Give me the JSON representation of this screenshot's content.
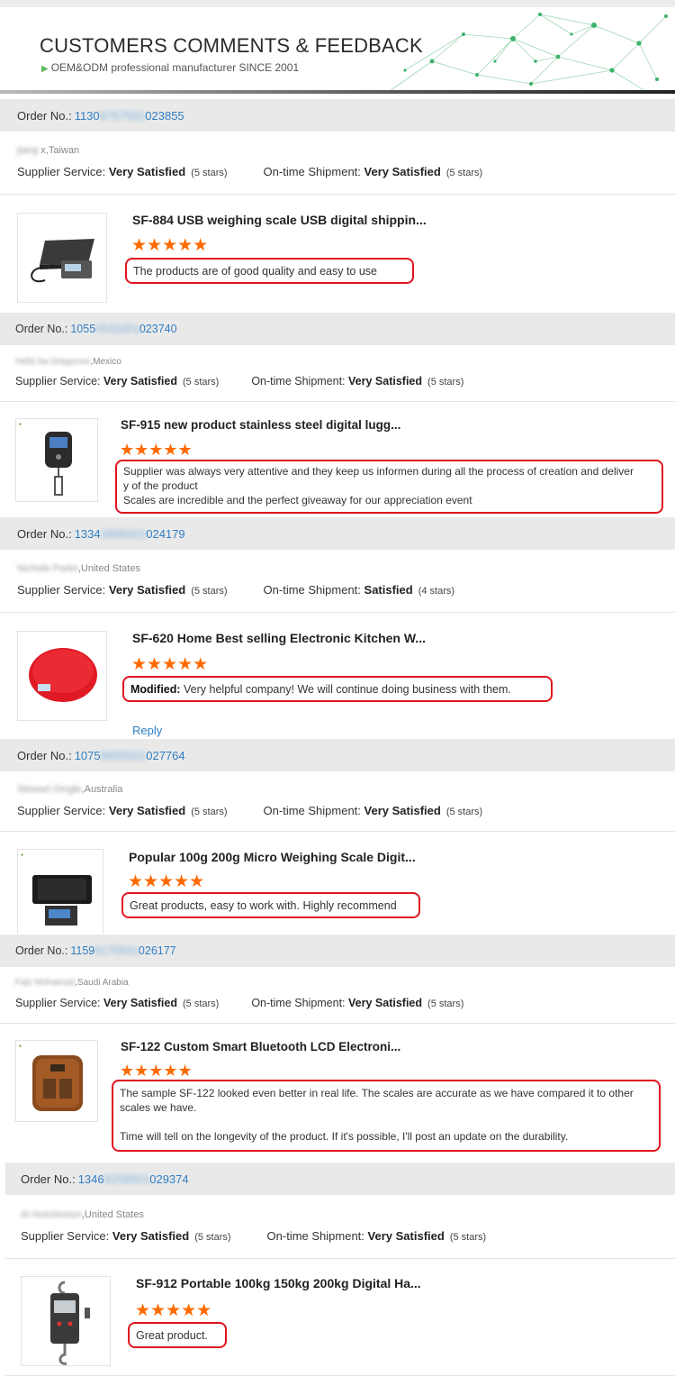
{
  "header": {
    "title": "CUSTOMERS COMMENTS & FEEDBACK",
    "subtitle": "OEM&ODM professional manufacturer SINCE 2001"
  },
  "labels": {
    "order_no": "Order No.:",
    "supplier_service": "Supplier Service:",
    "on_time_shipment": "On-time Shipment:",
    "reply": "Reply",
    "modified": "Modified:"
  },
  "stars_glyph": "★★★★★",
  "reviews": [
    {
      "order_prefix": "1130",
      "order_hidden": "9767501",
      "order_suffix": "023855",
      "customer_hidden": "jiang",
      "customer_visible": " x,Taiwan",
      "service": "Very Satisfied",
      "service_stars": "(5 stars)",
      "shipment": "Very Satisfied",
      "shipment_stars": "(5 stars)",
      "product": "SF-884 USB weighing scale USB digital shippin...",
      "comment_lines": [
        "The products are of good quality and easy to use"
      ]
    },
    {
      "order_prefix": "1055",
      "order_hidden": "0531001",
      "order_suffix": "023740",
      "customer_hidden": "Hefzi ba Dragonne",
      "customer_visible": ",Mexico",
      "service": "Very Satisfied",
      "service_stars": "(5 stars)",
      "shipment": "Very Satisfied",
      "shipment_stars": "(5 stars)",
      "product": "SF-915 new product stainless steel digital lugg...",
      "comment_lines": [
        "Supplier was always very attentive and they keep us informen during all the process of creation and deliver",
        "y of the product",
        "Scales are incredible and the perfect giveaway for our appreciation event"
      ]
    },
    {
      "order_prefix": "1334",
      "order_hidden": "2895001",
      "order_suffix": "024179",
      "customer_hidden": "Nichole Parks",
      "customer_visible": ",United States",
      "service": "Very Satisfied",
      "service_stars": "(5 stars)",
      "shipment": "Satisfied",
      "shipment_stars": "(4 stars)",
      "product": "SF-620 Home Best selling Electronic Kitchen W...",
      "modified_text": "Very helpful company! We will continue doing business with them."
    },
    {
      "order_prefix": "1075",
      "order_hidden": "8955501",
      "order_suffix": "027764",
      "customer_hidden": "Stewart Dingle",
      "customer_visible": ",Australia",
      "service": "Very Satisfied",
      "service_stars": "(5 stars)",
      "shipment": "Very Satisfied",
      "shipment_stars": "(5 stars)",
      "product": "Popular 100g 200g Micro Weighing Scale Digit...",
      "comment_lines": [
        "Great products, easy to work with. Highly recommend"
      ]
    },
    {
      "order_prefix": "1159",
      "order_hidden": "6170501",
      "order_suffix": "026177",
      "customer_hidden": "Faiz Mohamad",
      "customer_visible": ",Saudi Arabia",
      "service": "Very Satisfied",
      "service_stars": "(5 stars)",
      "shipment": "Very Satisfied",
      "shipment_stars": "(5 stars)",
      "product": "SF-122 Custom Smart Bluetooth LCD Electroni...",
      "comment_lines": [
        "The sample SF-122 looked even better in real life. The scales are accurate as we have compared it to other",
        "scales we have.",
        "",
        "Time will tell on the longevity of the product. If it's possible, I'll post an update on the durability."
      ]
    },
    {
      "order_prefix": "1346",
      "order_hidden": "9259501",
      "order_suffix": "029374",
      "customer_hidden": "Al Hutchinson",
      "customer_visible": ",United States",
      "service": "Very Satisfied",
      "service_stars": "(5 stars)",
      "shipment": "Very Satisfied",
      "shipment_stars": "(5 stars)",
      "product": "SF-912 Portable 100kg 150kg 200kg Digital Ha...",
      "comment_lines": [
        "Great product."
      ]
    }
  ],
  "colors": {
    "accent_link": "#2f7ec4",
    "star": "#ff6a00",
    "highlight_border": "#e0141e",
    "order_bar_bg": "#e9e9e9"
  }
}
